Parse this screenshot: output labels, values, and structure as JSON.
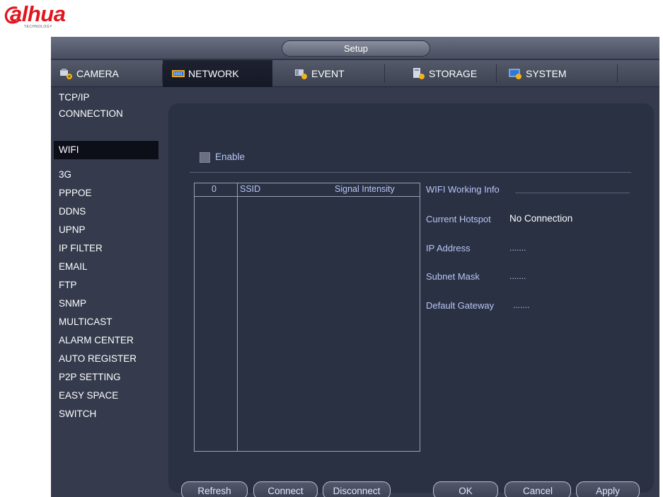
{
  "brand": {
    "name": "alhua",
    "tagline": "TECHNOLOGY",
    "color": "#e0161f"
  },
  "window": {
    "title": "Setup"
  },
  "tabs": [
    {
      "label": "CAMERA",
      "icon": "camera-icon",
      "active": false
    },
    {
      "label": "NETWORK",
      "icon": "network-icon",
      "active": true
    },
    {
      "label": "EVENT",
      "icon": "event-icon",
      "active": false
    },
    {
      "label": "STORAGE",
      "icon": "storage-icon",
      "active": false
    },
    {
      "label": "SYSTEM",
      "icon": "system-icon",
      "active": false
    }
  ],
  "sidebar": {
    "active": "WIFI",
    "items": [
      "TCP/IP",
      "CONNECTION",
      "WIFI",
      "3G",
      "PPPOE",
      "DDNS",
      "UPNP",
      "IP FILTER",
      "EMAIL",
      "FTP",
      "SNMP",
      "MULTICAST",
      "ALARM CENTER",
      "AUTO REGISTER",
      "P2P SETTING",
      "EASY SPACE",
      "SWITCH"
    ]
  },
  "wifi": {
    "enable_label": "Enable",
    "enabled": false,
    "list": {
      "columns": {
        "index": "0",
        "ssid": "SSID",
        "signal": "Signal Intensity"
      },
      "rows": []
    },
    "info": {
      "title": "WIFI Working Info",
      "current_hotspot_label": "Current Hotspot",
      "current_hotspot_value": "No Connection",
      "ip_address_label": "IP Address",
      "ip_address_value": ".......",
      "subnet_mask_label": "Subnet Mask",
      "subnet_mask_value": ".......",
      "default_gateway_label": "Default Gateway",
      "default_gateway_value": "......."
    }
  },
  "buttons": {
    "refresh": "Refresh",
    "connect": "Connect",
    "disconnect": "Disconnect",
    "ok": "OK",
    "cancel": "Cancel",
    "apply": "Apply"
  },
  "colors": {
    "background": "#353b4d",
    "panel": "#2a3143",
    "label_text": "#b8c6f5",
    "value_text": "#ffffff",
    "selected_item": "#0c0f18"
  }
}
